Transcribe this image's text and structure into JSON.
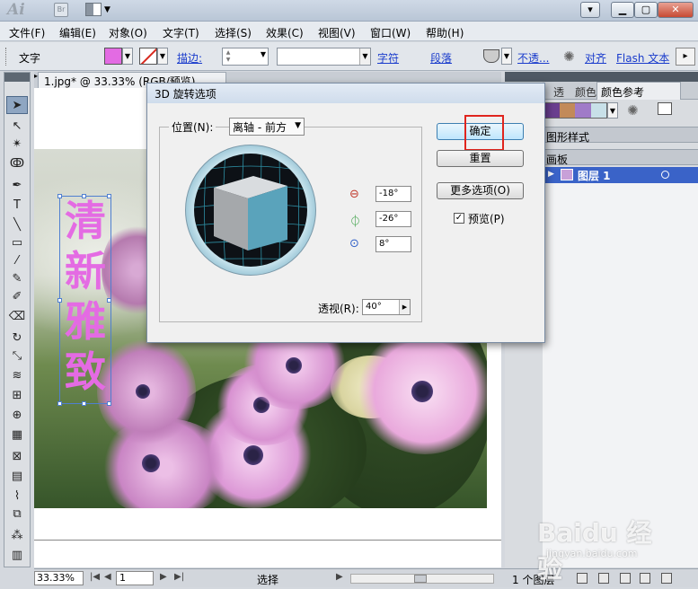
{
  "titlebar": {
    "logo": "Ai",
    "br": "Br"
  },
  "menu": [
    "文件(F)",
    "编辑(E)",
    "对象(O)",
    "文字(T)",
    "选择(S)",
    "效果(C)",
    "视图(V)",
    "窗口(W)",
    "帮助(H)"
  ],
  "control": {
    "mode_label": "文字",
    "fill_color": "#e36be3",
    "stroke_label": "描边:",
    "char_link": "字符",
    "para_link": "段落",
    "opacity_link": "不透...",
    "align_link": "对齐",
    "flash_link": "Flash 文本"
  },
  "document": {
    "tab_title": "1.jpg* @ 33.33% (RGB/预览)",
    "vertical_text": "清新雅致",
    "text_color": "#e46be3"
  },
  "dialog": {
    "title": "3D 旋转选项",
    "position_label": "位置(N):",
    "position_value": "离轴 - 前方",
    "rot_x": "-18°",
    "rot_y": "-26°",
    "rot_z": "8°",
    "perspective_label": "透视(R):",
    "perspective_value": "40°",
    "ok": "确定",
    "reset": "重置",
    "more_options": "更多选项(O)",
    "preview_label": "预览(P)",
    "preview_checked": true,
    "cube_front_color": "#5aa3bb"
  },
  "panels": {
    "tab_transparency": "透",
    "tab_color": "颜色",
    "tab_color_guide": "颜色参考",
    "harmony_colors": [
      "#6a3f8f",
      "#c28a5a",
      "#a07bc8",
      "#c8e0e8"
    ],
    "graphic_styles": "图形样式",
    "artboards": "画板",
    "layer_name": "图层 1",
    "layer_count": "1 个图层"
  },
  "status": {
    "zoom": "33.33%",
    "page": "1",
    "mode": "选择"
  },
  "watermark": {
    "main": "Baidu 经验",
    "url": "jingyan.baidu.com"
  }
}
